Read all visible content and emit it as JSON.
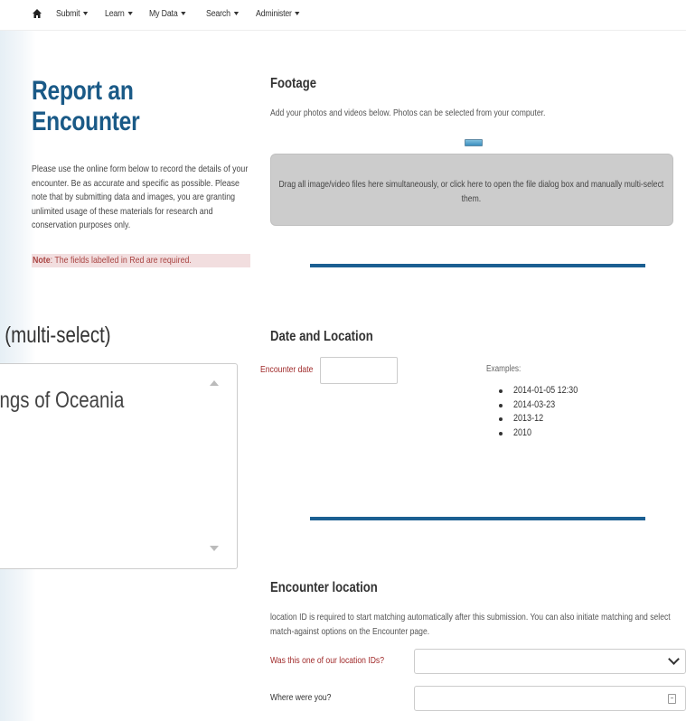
{
  "nav": {
    "items": [
      "Submit",
      "Learn",
      "My Data",
      "Search",
      "Administer"
    ]
  },
  "left": {
    "title": "Report an Encounter",
    "intro": "Please use the online form below to record the details of your encounter. Be as accurate and specific as possible. Please note that by submitting data and images, you are granting unlimited usage of these materials for research and conservation purposes only.",
    "note_label": "Note",
    "note_text": ": The fields labelled in Red are required."
  },
  "multiselect": {
    "heading": "s (multi-select)",
    "option": "dings of Oceania"
  },
  "footage": {
    "title": "Footage",
    "description": "Add your photos and videos below. Photos can be selected from your computer.",
    "dropzone_text": "Drag all image/video files here simultaneously, or click here to open the file dialog box and manually multi-select them."
  },
  "date_location": {
    "title": "Date and Location",
    "date_label": "Encounter date",
    "date_value": "",
    "examples_label": "Examples:",
    "examples": [
      "2014-01-05 12:30",
      "2014-03-23",
      "2013-12",
      "2010"
    ]
  },
  "encounter_location": {
    "title": "Encounter location",
    "description": "location ID is required to start matching automatically after this submission. You can also initiate matching and select match-against options on the Encounter page.",
    "location_id_label": "Was this one of our location IDs?",
    "location_id_value": "",
    "where_label": "Where were you?",
    "where_value": ""
  },
  "colors": {
    "title_blue": "#1a5a87",
    "divider_blue": "#1b5f92",
    "required_red": "#a02a2a",
    "note_bg": "#f2dedf"
  }
}
